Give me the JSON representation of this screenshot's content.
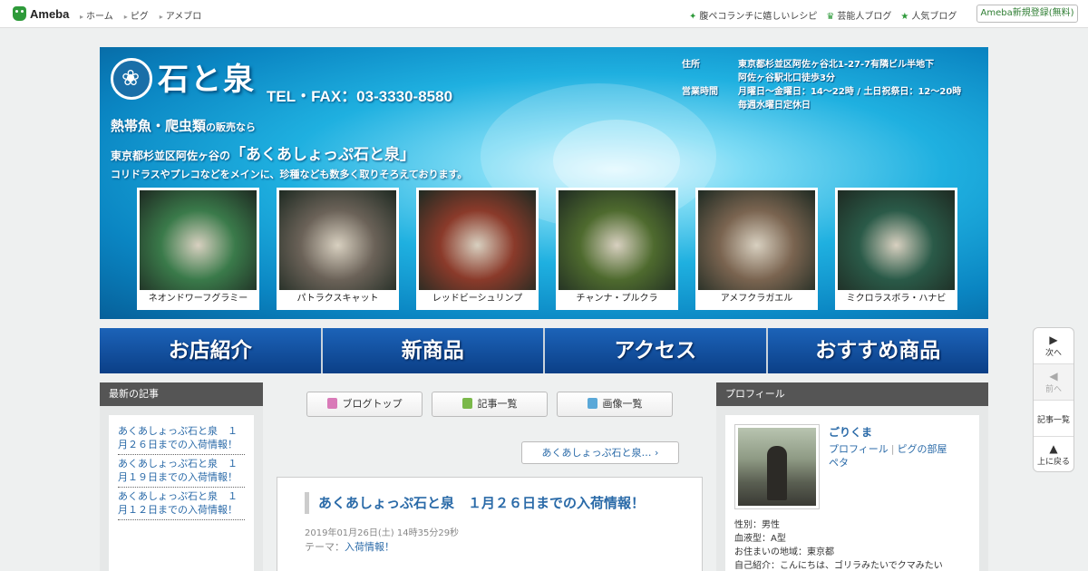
{
  "topbar": {
    "logo": "Ameba",
    "nav": [
      "ホーム",
      "ピグ",
      "アメブロ"
    ],
    "links": [
      {
        "icon": "sparkle-icon",
        "label": "腹ペコランチに嬉しいレシピ"
      },
      {
        "icon": "crown-icon",
        "label": "芸能人ブログ"
      },
      {
        "icon": "star-icon",
        "label": "人気ブログ"
      }
    ],
    "signup": "Ameba新規登録(無料)"
  },
  "banner": {
    "shop_name": "石と泉",
    "tel": "TEL・FAX：03-3330-8580",
    "catch_main": "熱帯魚・爬虫類",
    "catch_main_suffix": "の販売なら",
    "catch_sub_prefix": "東京都杉並区阿佐ヶ谷の",
    "catch_sub_name": "「あくあしょっぷ石と泉」",
    "catch_desc": "コリドラスやプレコなどをメインに、珍種なども数多く取りそろえております。",
    "address_label": "住所",
    "address_1": "東京都杉並区阿佐ヶ谷北1-27-7有隣ビル半地下",
    "address_2": "阿佐ヶ谷駅北口徒歩3分",
    "hours_label": "営業時間",
    "hours_1": "月曜日～金曜日：14～22時 / 土日祝祭日：12～20時",
    "hours_2": "毎週水曜日定休日",
    "photos": [
      {
        "caption": "ネオンドワーフグラミー",
        "color": "#3a7a4a"
      },
      {
        "caption": "パトラクスキャット",
        "color": "#6b6258"
      },
      {
        "caption": "レッドビーシュリンプ",
        "color": "#8a3a2a"
      },
      {
        "caption": "チャンナ・プルクラ",
        "color": "#4e6a2e"
      },
      {
        "caption": "アメフクラガエル",
        "color": "#7a6450"
      },
      {
        "caption": "ミクロラスボラ・ハナビ",
        "color": "#2a5a48"
      }
    ]
  },
  "main_nav": [
    "お店紹介",
    "新商品",
    "アクセス",
    "おすすめ商品"
  ],
  "left": {
    "heading": "最新の記事",
    "entries": [
      "あくあしょっぷ石と泉　１月２６日までの入荷情報！",
      "あくあしょっぷ石と泉　１月１９日までの入荷情報！",
      "あくあしょっぷ石と泉　１月１２日までの入荷情報！"
    ]
  },
  "center": {
    "tools": [
      {
        "icon": "document-icon",
        "label": "ブログトップ",
        "color": "#d97ab8"
      },
      {
        "icon": "list-icon",
        "label": "記事一覧",
        "color": "#7ab84a"
      },
      {
        "icon": "camera-icon",
        "label": "画像一覧",
        "color": "#5aa8d8"
      }
    ],
    "crumb": "あくあしょっぷ石と泉…",
    "article": {
      "title": "あくあしょっぷ石と泉　１月２６日までの入荷情報！",
      "date": "2019年01月26日(土) 14時35分29秒",
      "theme_label": "テーマ：",
      "theme": "入荷情報！"
    }
  },
  "right": {
    "heading": "プロフィール",
    "name": "ごりくま",
    "link_profile": "プロフィール",
    "link_pig": "ピグの部屋",
    "link_peta": "ペタ",
    "info": [
      "性別：男性",
      "血液型：A型",
      "お住まいの地域：東京都",
      "自己紹介：こんにちは、ゴリラみたいでクマみたい"
    ]
  },
  "sidefloat": {
    "next": "次へ",
    "prev": "前へ",
    "list": "記事一覧",
    "top": "上に戻る"
  }
}
